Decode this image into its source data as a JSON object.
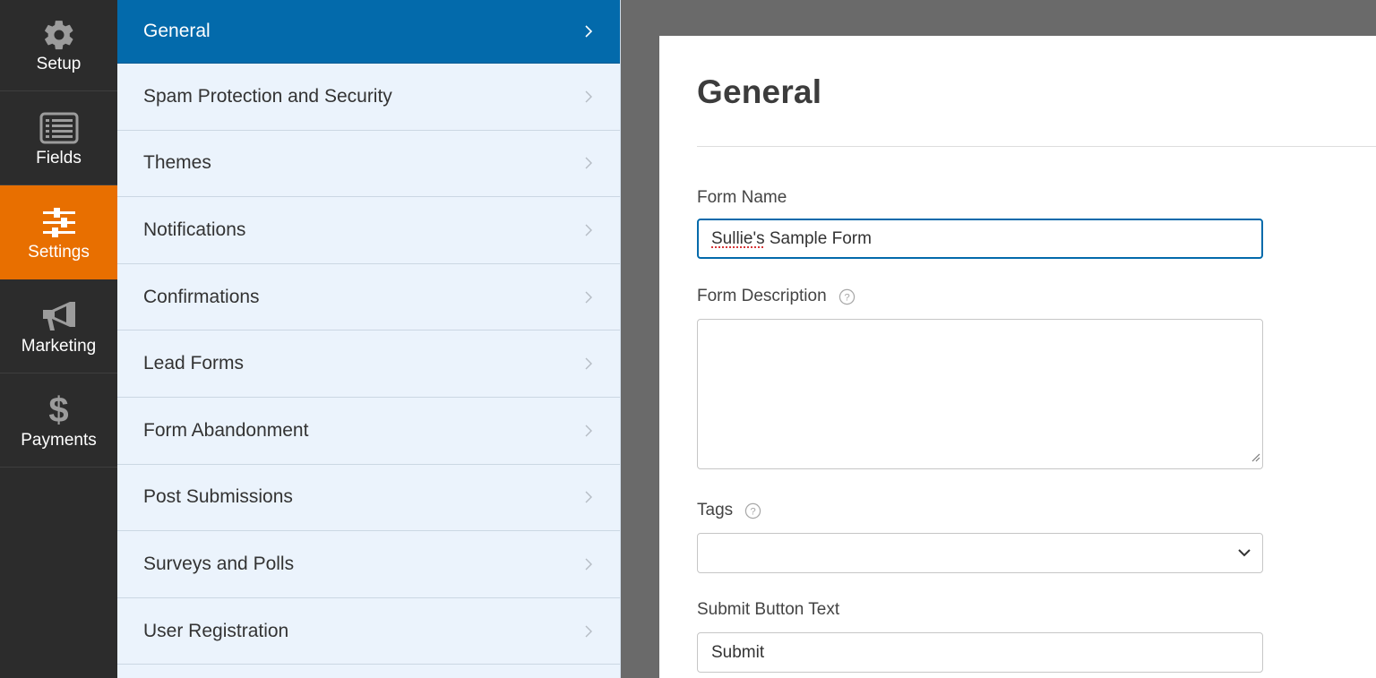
{
  "rail": {
    "items": [
      {
        "label": "Setup",
        "icon": "gear-icon"
      },
      {
        "label": "Fields",
        "icon": "list-icon"
      },
      {
        "label": "Settings",
        "icon": "sliders-icon",
        "active": true
      },
      {
        "label": "Marketing",
        "icon": "megaphone-icon"
      },
      {
        "label": "Payments",
        "icon": "dollar-icon",
        "glyph": "$"
      }
    ],
    "active_color": "#e86f00"
  },
  "submenu": {
    "items": [
      {
        "label": "General",
        "active": true
      },
      {
        "label": "Spam Protection and Security"
      },
      {
        "label": "Themes"
      },
      {
        "label": "Notifications"
      },
      {
        "label": "Confirmations"
      },
      {
        "label": "Lead Forms"
      },
      {
        "label": "Form Abandonment"
      },
      {
        "label": "Post Submissions"
      },
      {
        "label": "Surveys and Polls"
      },
      {
        "label": "User Registration"
      }
    ],
    "active_color": "#036aab"
  },
  "panel": {
    "title": "General",
    "form_name": {
      "label": "Form Name",
      "value_misspelled": "Sullie's",
      "value_rest": " Sample Form"
    },
    "form_description": {
      "label": "Form Description",
      "value": ""
    },
    "tags": {
      "label": "Tags",
      "selected": ""
    },
    "submit_button_text": {
      "label": "Submit Button Text",
      "value": "Submit"
    }
  }
}
